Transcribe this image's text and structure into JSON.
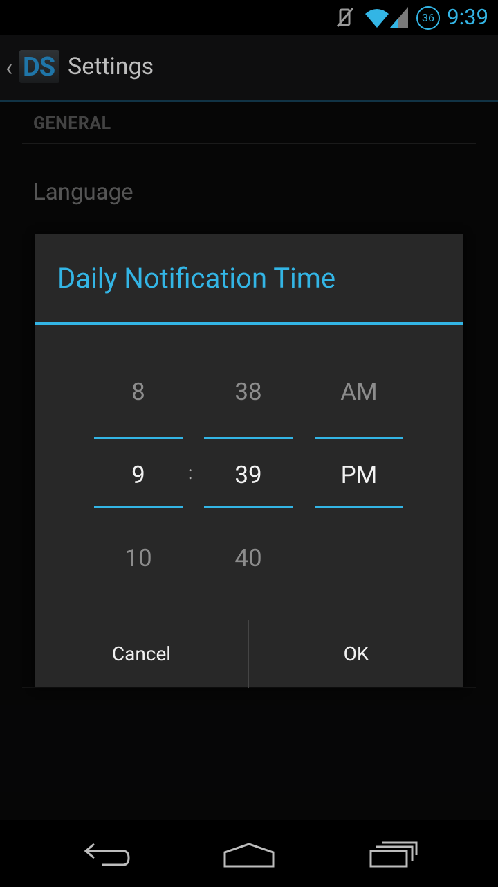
{
  "status_bar": {
    "time": "9:39",
    "notification_badge": "36"
  },
  "action_bar": {
    "logo_text": "DS",
    "title": "Settings"
  },
  "settings": {
    "section_header": "GENERAL",
    "first_item": "Language"
  },
  "dialog": {
    "title": "Daily Notification Time",
    "hour": {
      "prev": "8",
      "current": "9",
      "next": "10"
    },
    "separator": ":",
    "minute": {
      "prev": "38",
      "current": "39",
      "next": "40"
    },
    "ampm": {
      "prev": "AM",
      "current": "PM"
    },
    "cancel_label": "Cancel",
    "ok_label": "OK"
  },
  "colors": {
    "accent": "#33b5e5",
    "dialog_bg": "#282828",
    "background": "#0b0b0c"
  },
  "icons": {
    "status": [
      "vibrate-off-icon",
      "wifi-icon",
      "cell-signal-icon",
      "notification-badge-icon"
    ],
    "nav": [
      "back-icon",
      "home-icon",
      "recents-icon"
    ]
  }
}
